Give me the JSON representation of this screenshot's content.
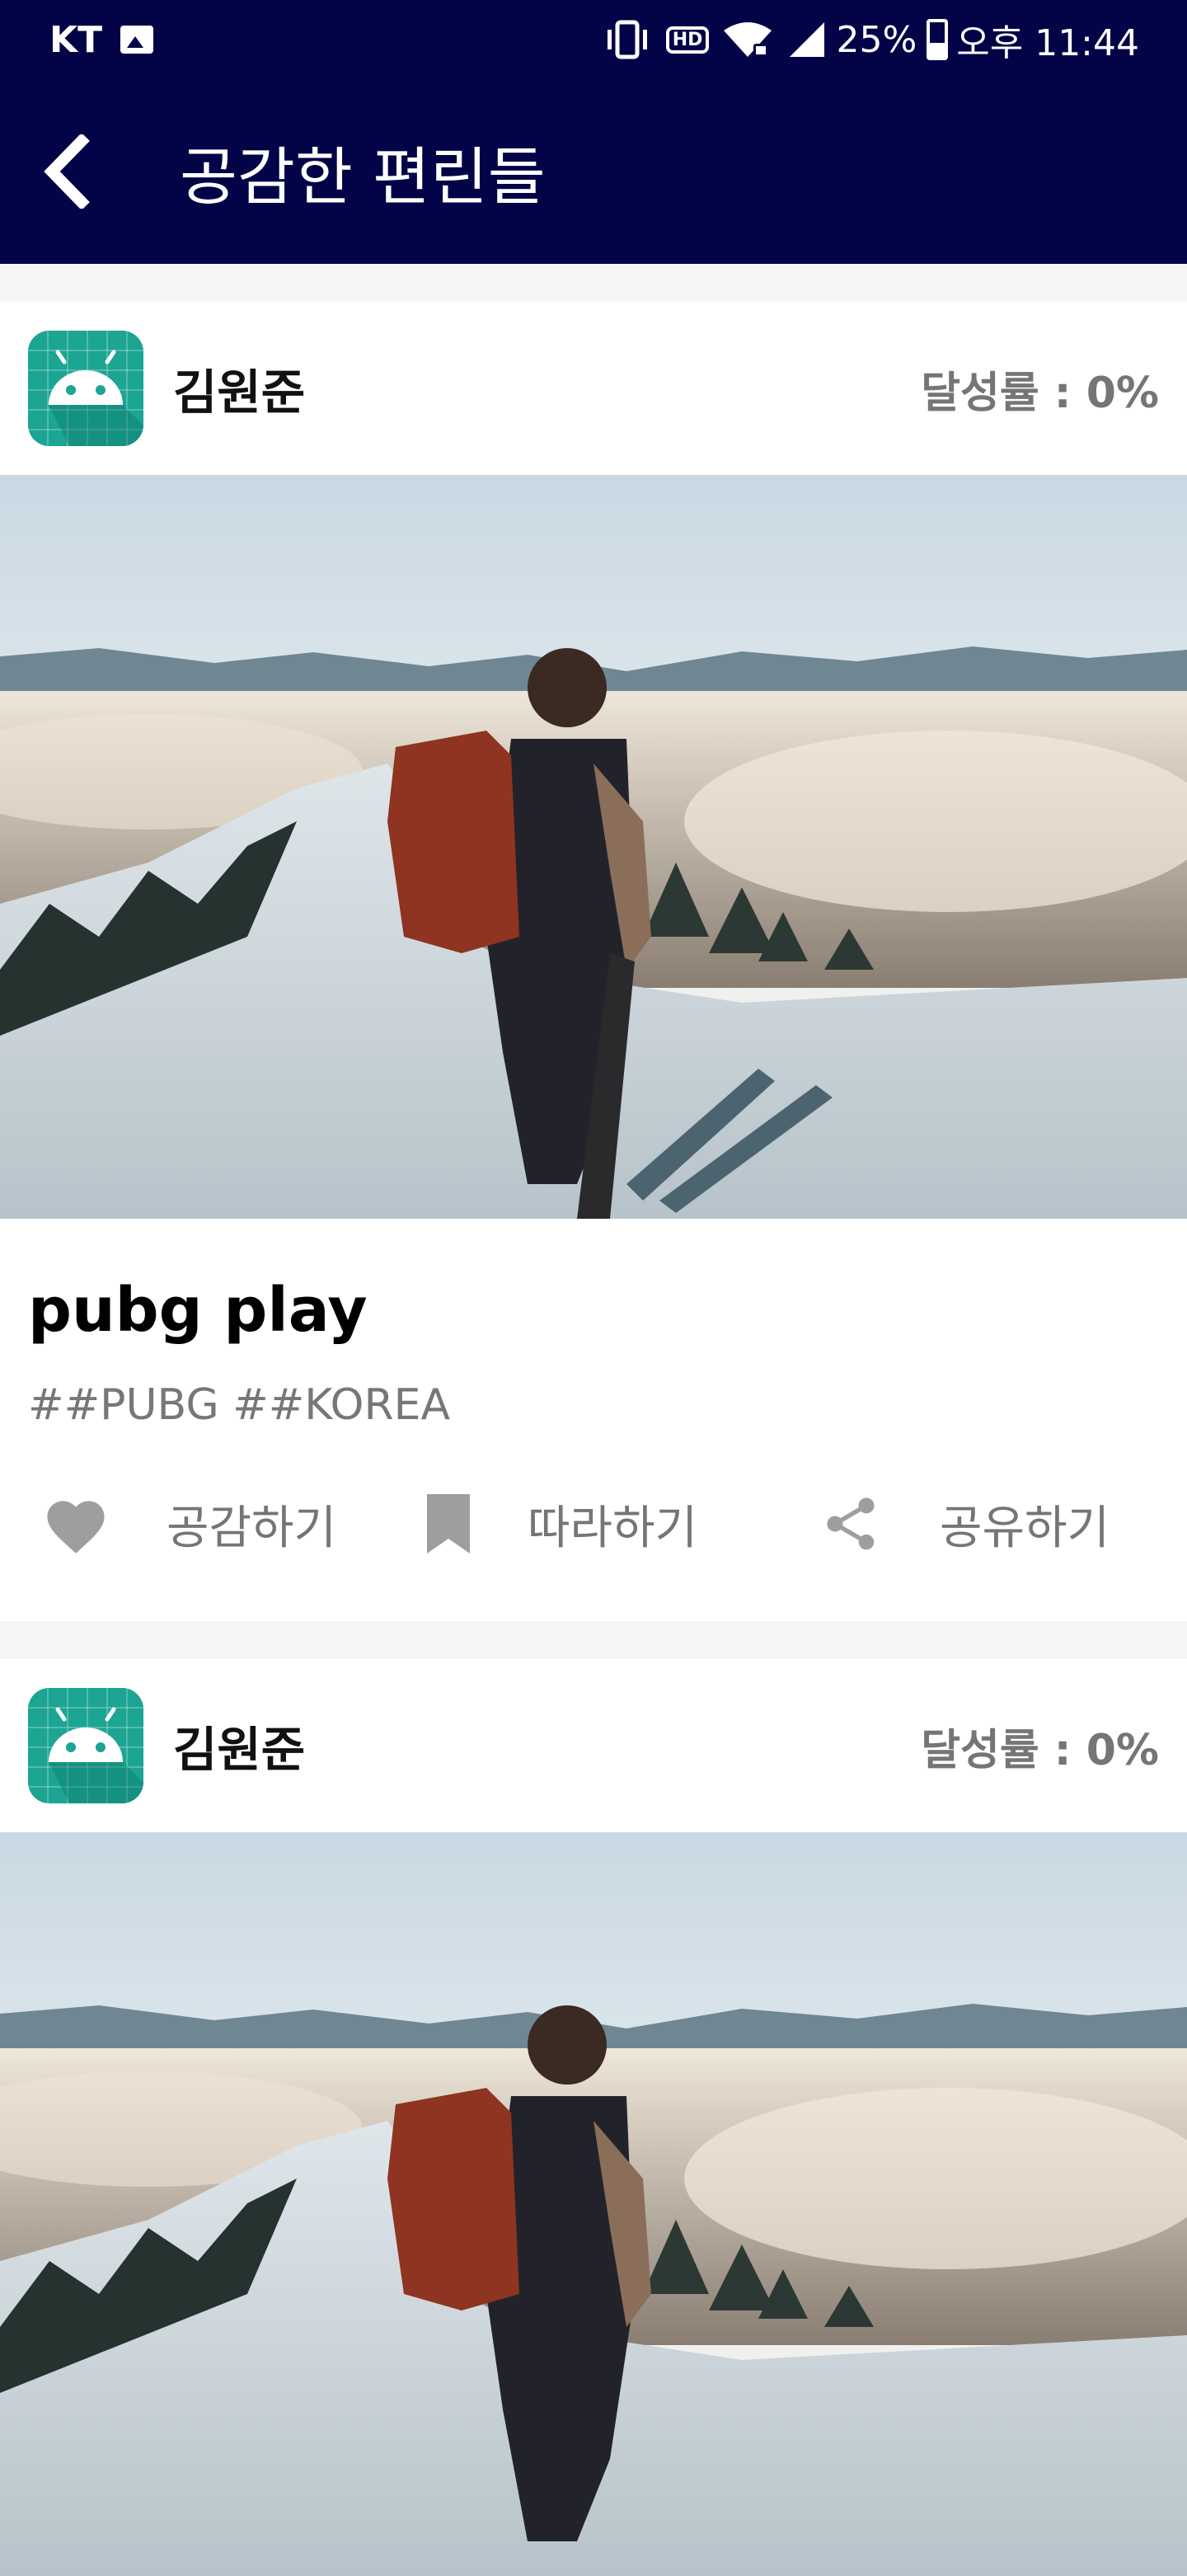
{
  "status_bar": {
    "carrier": "KT",
    "battery": "25%",
    "time": "오후 11:44",
    "icons": [
      "image-icon",
      "vibrate-icon",
      "hd-icon",
      "wifi-icon",
      "signal-icon",
      "battery-icon"
    ]
  },
  "app_bar": {
    "title": "공감한 편린들",
    "back_icon": "back-arrow-icon",
    "background": "#030347"
  },
  "posts": [
    {
      "author": "김원준",
      "achievement": "달성률 : 0%",
      "title": "pubg play",
      "tags": "##PUBG ##KOREA",
      "actions": {
        "like": "공감하기",
        "follow": "따라하기",
        "share": "공유하기"
      }
    },
    {
      "author": "김원준",
      "achievement": "달성률 : 0%"
    }
  ],
  "colors": {
    "primary_dark": "#030347",
    "avatar_bg": "#1ba592",
    "icon_gray": "#9e9e9e",
    "text_gray": "#757575"
  }
}
